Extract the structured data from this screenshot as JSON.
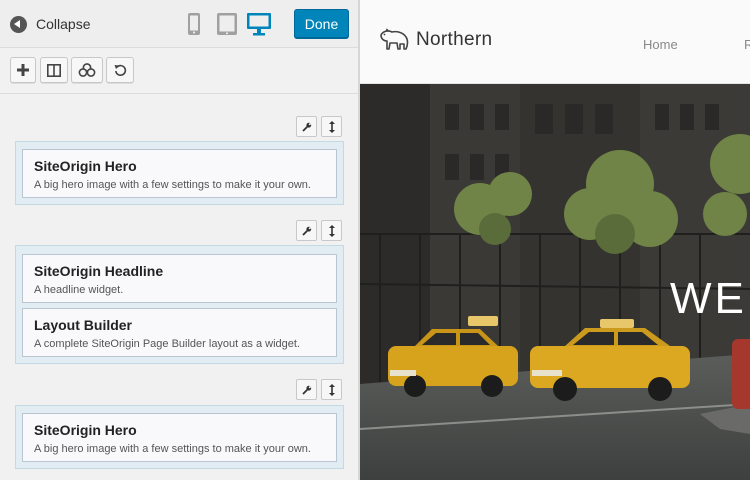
{
  "header": {
    "collapse_label": "Collapse",
    "done_label": "Done",
    "devices": [
      "mobile-icon",
      "tablet-icon",
      "desktop-icon"
    ],
    "active_device": "desktop"
  },
  "toolbar": {
    "buttons": [
      "add-widget-icon",
      "add-row-icon",
      "prebuilt-layouts-icon",
      "history-icon"
    ]
  },
  "rows": [
    {
      "widgets": [
        {
          "title": "SiteOrigin Hero",
          "description": "A big hero image with a few settings to make it your own."
        }
      ]
    },
    {
      "widgets": [
        {
          "title": "SiteOrigin Headline",
          "description": "A headline widget."
        },
        {
          "title": "Layout Builder",
          "description": "A complete SiteOrigin Page Builder layout as a widget."
        }
      ]
    },
    {
      "widgets": [
        {
          "title": "SiteOrigin Hero",
          "description": "A big hero image with a few settings to make it your own."
        }
      ]
    }
  ],
  "preview": {
    "logo_text": "Northern",
    "nav": [
      "Home",
      "R"
    ],
    "hero_text": "WE I"
  },
  "colors": {
    "accent": "#0085ba",
    "row_bg": "#e2ecf3",
    "widget_border": "#b9c6d1"
  }
}
